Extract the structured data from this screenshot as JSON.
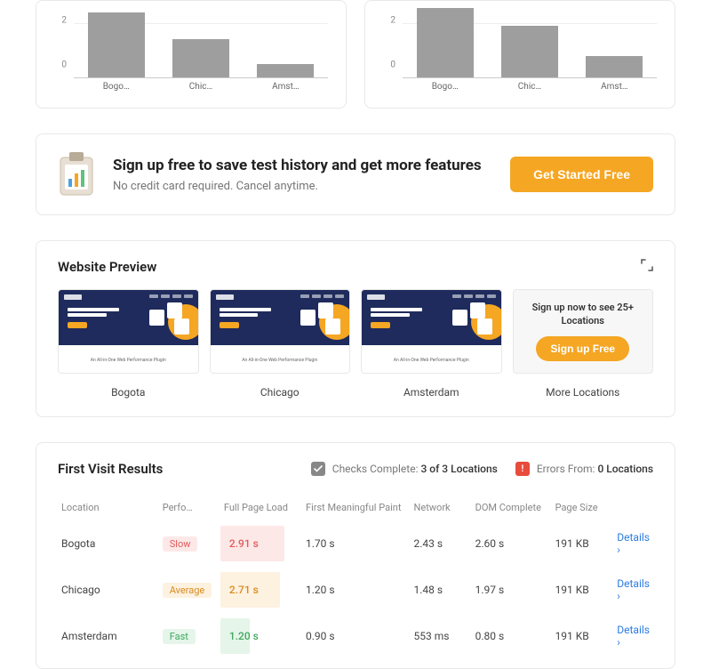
{
  "chart_data": [
    {
      "type": "bar",
      "ylim": [
        0,
        2.5
      ],
      "yticks": [
        0,
        2
      ],
      "categories": [
        "Bogo…",
        "Chic…",
        "Amst…"
      ],
      "values": [
        2.4,
        1.4,
        0.5
      ]
    },
    {
      "type": "bar",
      "ylim": [
        0,
        2.5
      ],
      "yticks": [
        0,
        2
      ],
      "categories": [
        "Bogo…",
        "Chic…",
        "Amst…"
      ],
      "values": [
        2.55,
        1.9,
        0.8
      ]
    }
  ],
  "cta": {
    "title": "Sign up free to save test history and get more features",
    "subtitle": "No credit card required. Cancel anytime.",
    "button": "Get Started Free"
  },
  "preview": {
    "title": "Website Preview",
    "thumbs": [
      {
        "label": "Bogota",
        "hero_line1": "The #1 WordPress",
        "hero_line2": "Caching Plugin",
        "footer": "An All-in-One Web Performance Plugin"
      },
      {
        "label": "Chicago",
        "hero_line1": "The #1 WordPress",
        "hero_line2": "Caching Plugin",
        "footer": "An All-in-One Web Performance Plugin"
      },
      {
        "label": "Amsterdam",
        "hero_line1": "The #1 WordPress",
        "hero_line2": "Caching Plugin",
        "footer": "An All-in-One Web Performance Plugin"
      }
    ],
    "signup": {
      "text": "Sign up now to see 25+ Locations",
      "button": "Sign up Free"
    },
    "more_label": "More Locations"
  },
  "results": {
    "title": "First Visit Results",
    "checks_label": "Checks Complete:",
    "checks_value": "3 of 3 Locations",
    "errors_label": "Errors From:",
    "errors_value": "0 Locations",
    "headers": {
      "loc": "Location",
      "perf": "Perfo…",
      "load": "Full Page Load",
      "fmp": "First Meaningful Paint",
      "net": "Network",
      "dom": "DOM Complete",
      "size": "Page Size"
    },
    "rows": [
      {
        "loc": "Bogota",
        "perf": "Slow",
        "perf_class": "slow",
        "load": "2.91 s",
        "load_pct": 78,
        "fmp": "1.70 s",
        "net": "2.43 s",
        "dom": "2.60 s",
        "size": "191 KB"
      },
      {
        "loc": "Chicago",
        "perf": "Average",
        "perf_class": "avg",
        "load": "2.71 s",
        "load_pct": 73,
        "fmp": "1.20 s",
        "net": "1.48 s",
        "dom": "1.97 s",
        "size": "191 KB"
      },
      {
        "loc": "Amsterdam",
        "perf": "Fast",
        "perf_class": "fast",
        "load": "1.20 s",
        "load_pct": 36,
        "fmp": "0.90 s",
        "net": "553 ms",
        "dom": "0.80 s",
        "size": "191 KB"
      }
    ],
    "details": "Details"
  }
}
